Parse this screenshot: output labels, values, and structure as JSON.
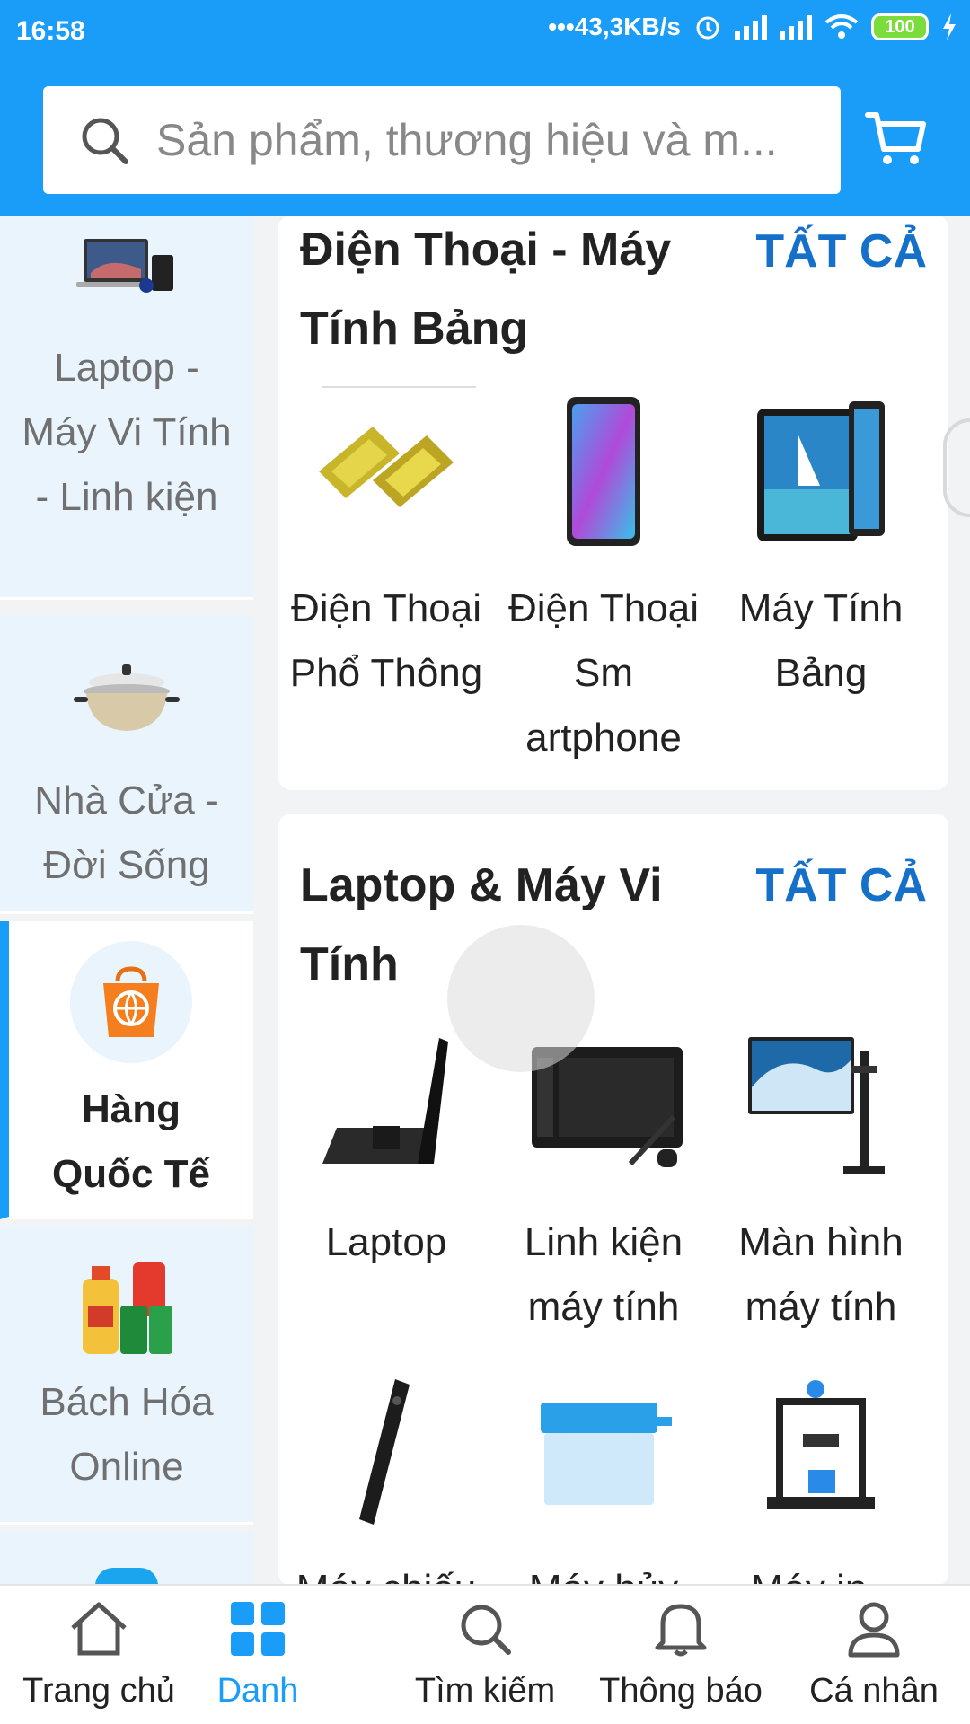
{
  "status_bar": {
    "time": "16:58",
    "network_speed": "•••43,3KB/s",
    "battery": "100"
  },
  "search": {
    "placeholder": "Sản phẩm, thương hiệu và m..."
  },
  "sidebar": {
    "items": [
      {
        "label": "Laptop - Máy Vi Tính - Linh kiện",
        "icon": "laptop-icon"
      },
      {
        "label": "Nhà Cửa - Đời Sống",
        "icon": "cooking-pot-icon"
      },
      {
        "label": "Hàng Quốc Tế",
        "icon": "global-shopping-bag-icon",
        "active": true
      },
      {
        "label": "Bách Hóa Online",
        "icon": "grocery-icon"
      }
    ]
  },
  "sections": [
    {
      "title": "Điện Thoại - Máy Tính Bảng",
      "see_all": "TẤT CẢ",
      "items": [
        {
          "label": "Điện Thoại Phổ Thông"
        },
        {
          "label": "Điện Thoại Sm artphone"
        },
        {
          "label": "Máy Tính Bảng"
        }
      ]
    },
    {
      "title": "Laptop & Máy Vi Tính",
      "see_all": "TẤT CẢ",
      "items": [
        {
          "label": "Laptop"
        },
        {
          "label": "Linh kiện máy tính"
        },
        {
          "label": "Màn hình máy tính"
        },
        {
          "label": "Máy chiếu"
        },
        {
          "label": "Máy hủy"
        },
        {
          "label": "Máy in -"
        }
      ]
    }
  ],
  "bottom_nav": [
    {
      "label": "Trang chủ",
      "icon": "home-icon"
    },
    {
      "label": "Danh",
      "icon": "grid-icon",
      "active": true
    },
    {
      "label": "Tìm kiếm",
      "icon": "search-icon"
    },
    {
      "label": "Thông báo",
      "icon": "bell-icon"
    },
    {
      "label": "Cá nhân",
      "icon": "user-icon"
    }
  ],
  "colors": {
    "brand": "#1a9df8",
    "link": "#1570c9",
    "sidebar_bg": "#e9f4fd"
  }
}
